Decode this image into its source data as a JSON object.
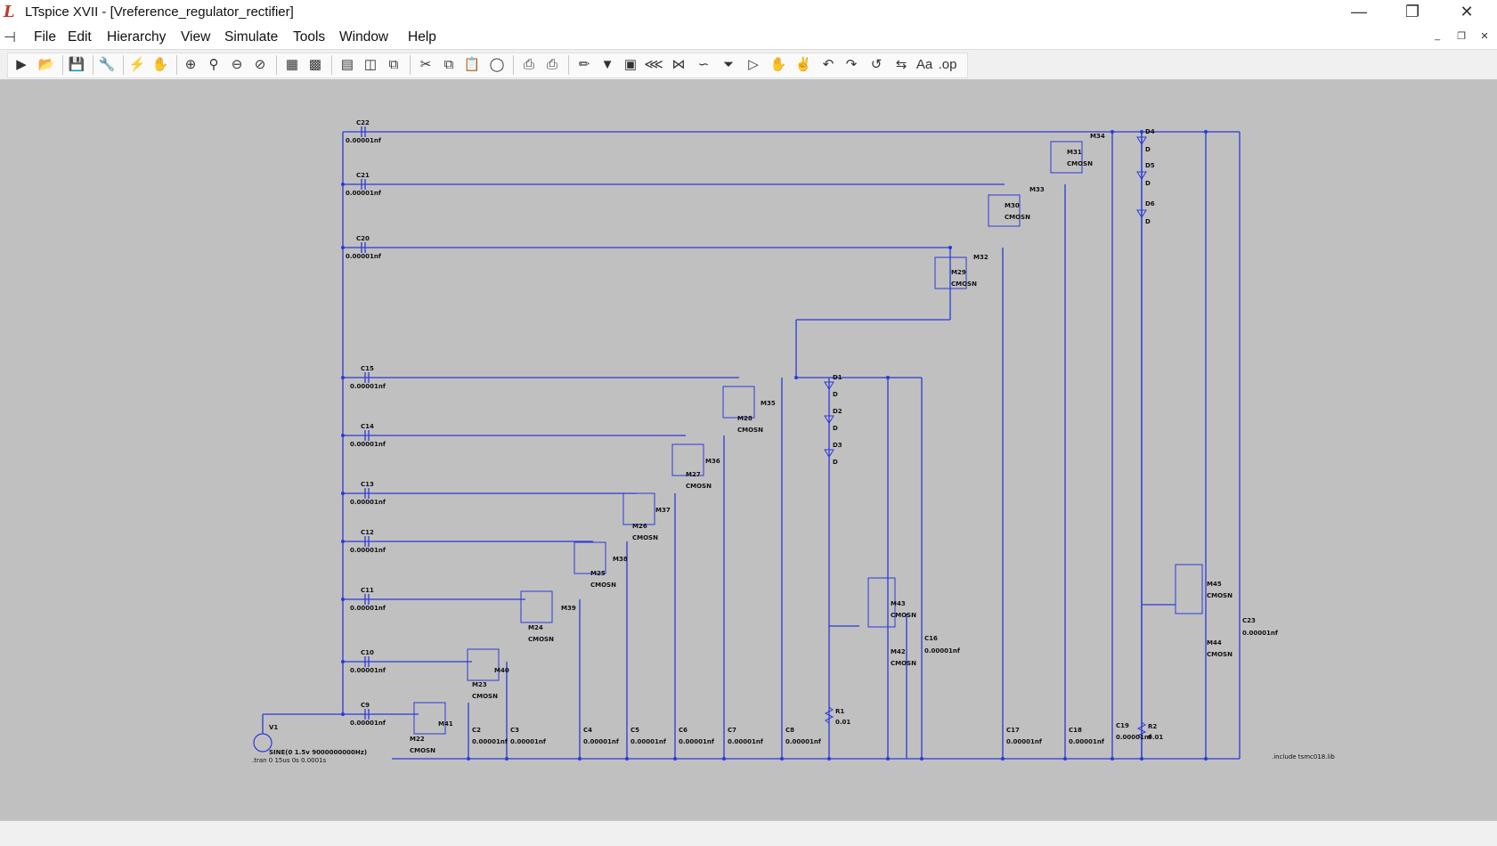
{
  "window": {
    "title": "LTspice XVII - [Vreference_regulator_rectifier]"
  },
  "menu": [
    "File",
    "Edit",
    "Hierarchy",
    "View",
    "Simulate",
    "Tools",
    "Window",
    "Help"
  ],
  "toolbar_icons": [
    "run-icon",
    "open-icon",
    "save-icon",
    "control-panel-icon",
    "halt-icon",
    "pan-icon",
    "zoom-in-icon",
    "zoom-full-icon",
    "zoom-out-icon",
    "zoom-cancel-icon",
    "autorange-icon",
    "setup-icon",
    "tile-horizontal-icon",
    "tile-vertical-icon",
    "cascade-icon",
    "cut-icon",
    "copy-icon",
    "paste-icon",
    "find-icon",
    "print-setup-icon",
    "print-icon",
    "wire-icon",
    "ground-icon",
    "label-net-icon",
    "resistor-icon",
    "capacitor-icon",
    "inductor-icon",
    "diode-icon",
    "component-icon",
    "move-icon",
    "drag-icon",
    "undo-icon",
    "redo-icon",
    "rotate-icon",
    "mirror-icon",
    "text-icon",
    "spice-directive-icon"
  ],
  "schematic": {
    "capacitors_left": [
      {
        "name": "C22",
        "value": "0.00001nf"
      },
      {
        "name": "C21",
        "value": "0.00001nf"
      },
      {
        "name": "C20",
        "value": "0.00001nf"
      },
      {
        "name": "C15",
        "value": "0.00001nf"
      },
      {
        "name": "C14",
        "value": "0.00001nf"
      },
      {
        "name": "C13",
        "value": "0.00001nf"
      },
      {
        "name": "C12",
        "value": "0.00001nf"
      },
      {
        "name": "C11",
        "value": "0.00001nf"
      },
      {
        "name": "C10",
        "value": "0.00001nf"
      },
      {
        "name": "C9",
        "value": "0.00001nf"
      }
    ],
    "capacitors_bottom": [
      {
        "name": "C2",
        "value": "0.00001nf"
      },
      {
        "name": "C3",
        "value": "0.00001nf"
      },
      {
        "name": "C4",
        "value": "0.00001nf"
      },
      {
        "name": "C5",
        "value": "0.00001nf"
      },
      {
        "name": "C6",
        "value": "0.00001nf"
      },
      {
        "name": "C7",
        "value": "0.00001nf"
      },
      {
        "name": "C8",
        "value": "0.00001nf"
      },
      {
        "name": "C17",
        "value": "0.00001nf"
      },
      {
        "name": "C18",
        "value": "0.00001nf"
      },
      {
        "name": "C19",
        "value": "0.00001nf"
      }
    ],
    "c16": {
      "name": "C16",
      "value": "0.00001nf"
    },
    "c23": {
      "name": "C23",
      "value": "0.00001nf"
    },
    "mosfets": [
      {
        "name": "M22",
        "model": "CMOSN"
      },
      {
        "name": "M41",
        "model": "CMOSN"
      },
      {
        "name": "M23",
        "model": "CMOSN"
      },
      {
        "name": "M40",
        "model": "CMOSN"
      },
      {
        "name": "M24",
        "model": "CMOSN"
      },
      {
        "name": "M39",
        "model": "CMOSN"
      },
      {
        "name": "M25",
        "model": "CMOSN"
      },
      {
        "name": "M38",
        "model": "CMOSN"
      },
      {
        "name": "M26",
        "model": "CMOSN"
      },
      {
        "name": "M37",
        "model": "CMOSN"
      },
      {
        "name": "M27",
        "model": "CMOSN"
      },
      {
        "name": "M36",
        "model": "CMOSN"
      },
      {
        "name": "M28",
        "model": "CMOSN"
      },
      {
        "name": "M35",
        "model": "CMOSN"
      },
      {
        "name": "M29",
        "model": "CMOSN"
      },
      {
        "name": "M32",
        "model": "CMOSN"
      },
      {
        "name": "M30",
        "model": "CMOSN"
      },
      {
        "name": "M33",
        "model": "CMOSN"
      },
      {
        "name": "M31",
        "model": "CMOSN"
      },
      {
        "name": "M34",
        "model": "CMOSN"
      },
      {
        "name": "M43",
        "model": "CMOSN"
      },
      {
        "name": "M42",
        "model": "CMOSN"
      },
      {
        "name": "M45",
        "model": "CMOSN"
      },
      {
        "name": "M44",
        "model": "CMOSN"
      }
    ],
    "diodes": [
      {
        "name": "D1",
        "model": "D"
      },
      {
        "name": "D2",
        "model": "D"
      },
      {
        "name": "D3",
        "model": "D"
      },
      {
        "name": "D4",
        "model": "D"
      },
      {
        "name": "D5",
        "model": "D"
      },
      {
        "name": "D6",
        "model": "D"
      }
    ],
    "resistors": [
      {
        "name": "R1",
        "value": "0.01"
      },
      {
        "name": "R2",
        "value": "0.01"
      }
    ],
    "source": {
      "name": "V1",
      "value": "SINE(0 1.5v 9000000000Hz)"
    },
    "directives": [
      ".tran 0 15us 0s 0.0001s",
      ".include tsmc018.lib"
    ]
  }
}
